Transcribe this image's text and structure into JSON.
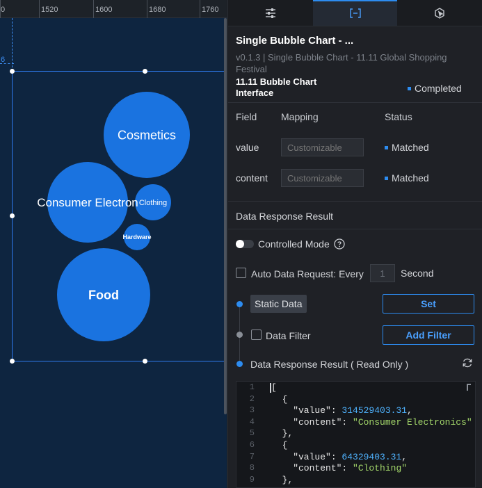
{
  "ruler": {
    "labels": [
      "0",
      "1520",
      "1600",
      "1680",
      "1760"
    ],
    "side_label": "6"
  },
  "chart_data": {
    "type": "bubble",
    "series": [
      {
        "label": "Cosmetics"
      },
      {
        "label": "Consumer Electron"
      },
      {
        "label": "Clothing"
      },
      {
        "label": "Hardware"
      },
      {
        "label": "Food"
      }
    ],
    "bubble_color": "#1a73e0"
  },
  "tabs": [
    {
      "name": "tab-style",
      "icon": "sliders-icon"
    },
    {
      "name": "tab-data",
      "icon": "data-bracket-icon"
    },
    {
      "name": "tab-interaction",
      "icon": "interaction-icon"
    }
  ],
  "panel": {
    "title": "Single Bubble Chart - ...",
    "subtitle": "v0.1.3 | Single Bubble Chart - 11.11 Global Shopping Festival"
  },
  "interface": {
    "name": "11.11 Bubble Chart Interface",
    "status": "Completed"
  },
  "fields": {
    "headers": {
      "field": "Field",
      "mapping": "Mapping",
      "status": "Status"
    },
    "rows": [
      {
        "name": "value",
        "placeholder": "Customizable",
        "status": "Matched"
      },
      {
        "name": "content",
        "placeholder": "Customizable",
        "status": "Matched"
      }
    ]
  },
  "data_response": {
    "heading": "Data Response Result",
    "controlled_mode": "Controlled Mode",
    "auto_request_label": "Auto Data Request: Every",
    "interval": "1",
    "interval_unit": "Second",
    "static_data": "Static Data",
    "set_button": "Set",
    "data_filter": "Data Filter",
    "add_filter_button": "Add Filter",
    "readonly_label": "Data Response Result ( Read Only )"
  },
  "code": {
    "line_numbers": [
      "1",
      "2",
      "3",
      "4",
      "5",
      "6",
      "7",
      "8",
      "9"
    ],
    "lines": [
      [
        {
          "t": "[",
          "c": "k"
        }
      ],
      [
        {
          "t": "  {",
          "c": "k"
        }
      ],
      [
        {
          "t": "    \"value\": ",
          "c": "k"
        },
        {
          "t": "314529403.31",
          "c": "n"
        },
        {
          "t": ",",
          "c": "k"
        }
      ],
      [
        {
          "t": "    \"content\": ",
          "c": "k"
        },
        {
          "t": "\"Consumer Electronics\"",
          "c": "s"
        }
      ],
      [
        {
          "t": "  },",
          "c": "k"
        }
      ],
      [
        {
          "t": "  {",
          "c": "k"
        }
      ],
      [
        {
          "t": "    \"value\": ",
          "c": "k"
        },
        {
          "t": "64329403.31",
          "c": "n"
        },
        {
          "t": ",",
          "c": "k"
        }
      ],
      [
        {
          "t": "    \"content\": ",
          "c": "k"
        },
        {
          "t": "\"Clothing\"",
          "c": "s"
        }
      ],
      [
        {
          "t": "  },",
          "c": "k"
        }
      ]
    ]
  },
  "colors": {
    "accent": "#2d8cf0",
    "canvas_bg": "#0e2540",
    "panel_bg": "#1f2126"
  }
}
